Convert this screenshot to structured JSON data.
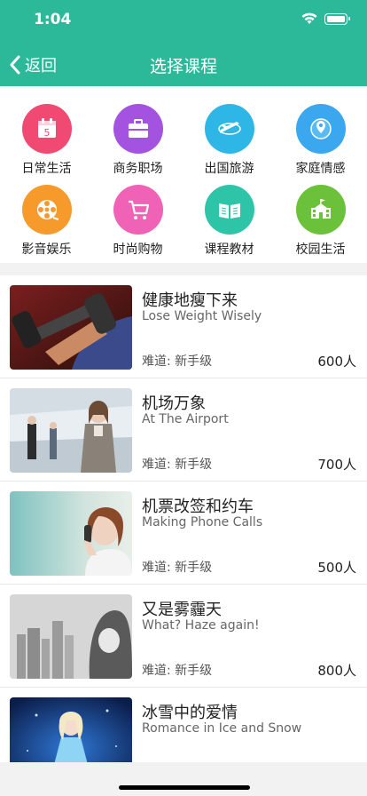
{
  "status": {
    "time": "1:04"
  },
  "nav": {
    "back_label": "返回",
    "title": "选择课程"
  },
  "colors": {
    "header": "#2bb99a"
  },
  "categories": [
    {
      "label": "日常生活",
      "icon": "calendar-icon",
      "color": "#f04a72"
    },
    {
      "label": "商务职场",
      "icon": "briefcase-icon",
      "color": "#a453e0"
    },
    {
      "label": "出国旅游",
      "icon": "airplane-icon",
      "color": "#2eb7e6"
    },
    {
      "label": "家庭情感",
      "icon": "location-pin-icon",
      "color": "#3ba7ee"
    },
    {
      "label": "影音娱乐",
      "icon": "film-reel-icon",
      "color": "#f59a2b"
    },
    {
      "label": "时尚购物",
      "icon": "shopping-cart-icon",
      "color": "#f062b6"
    },
    {
      "label": "课程教材",
      "icon": "book-icon",
      "color": "#2ec4a8"
    },
    {
      "label": "校园生活",
      "icon": "school-icon",
      "color": "#6cc13a"
    }
  ],
  "courses": [
    {
      "title": "健康地瘦下来",
      "subtitle": "Lose Weight Wisely",
      "level": "难道: 新手级",
      "count": "600人",
      "image": "dumbbell-workout-photo"
    },
    {
      "title": "机场万象",
      "subtitle": "At The Airport",
      "level": "难道: 新手级",
      "count": "700人",
      "image": "airport-travelers-photo"
    },
    {
      "title": "机票改签和约车",
      "subtitle": "Making Phone Calls",
      "level": "难道: 新手级",
      "count": "500人",
      "image": "woman-on-phone-photo"
    },
    {
      "title": "又是雾霾天",
      "subtitle": "What? Haze again!",
      "level": "难道: 新手级",
      "count": "800人",
      "image": "haze-city-mask-photo"
    },
    {
      "title": "冰雪中的爱情",
      "subtitle": "Romance in Ice and Snow",
      "level": "",
      "count": "",
      "image": "ice-princess-photo"
    }
  ]
}
